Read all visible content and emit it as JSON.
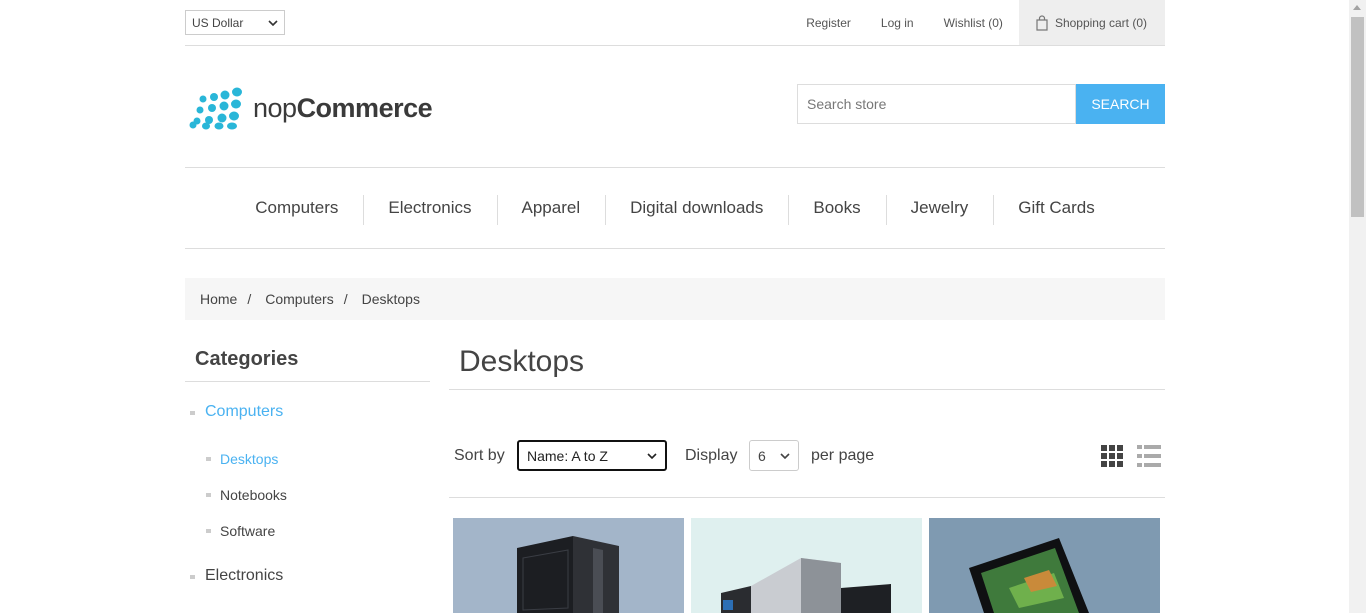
{
  "header": {
    "currency": "US Dollar",
    "links": {
      "register": "Register",
      "login": "Log in",
      "wishlist": "Wishlist (0)",
      "cart": "Shopping cart (0)"
    }
  },
  "logo": {
    "part1": "nop",
    "part2": "Commerce"
  },
  "search": {
    "placeholder": "Search store",
    "button": "SEARCH"
  },
  "menu": [
    "Computers",
    "Electronics",
    "Apparel",
    "Digital downloads",
    "Books",
    "Jewelry",
    "Gift Cards"
  ],
  "breadcrumb": {
    "home": "Home",
    "separator": "/",
    "level1": "Computers",
    "current": "Desktops"
  },
  "sidebar": {
    "title": "Categories",
    "categories": [
      {
        "label": "Computers",
        "active": true
      },
      {
        "label": "Electronics",
        "active": false
      }
    ],
    "subcategories": [
      {
        "label": "Desktops",
        "active": true
      },
      {
        "label": "Notebooks",
        "active": false
      },
      {
        "label": "Software",
        "active": false
      }
    ]
  },
  "main": {
    "title": "Desktops",
    "sort_label": "Sort by",
    "sort_value": "Name: A to Z",
    "display_label": "Display",
    "display_value": "6",
    "per_page_label": "per page"
  },
  "colors": {
    "accent": "#4ab2f1",
    "logo": "#29b6d8"
  }
}
